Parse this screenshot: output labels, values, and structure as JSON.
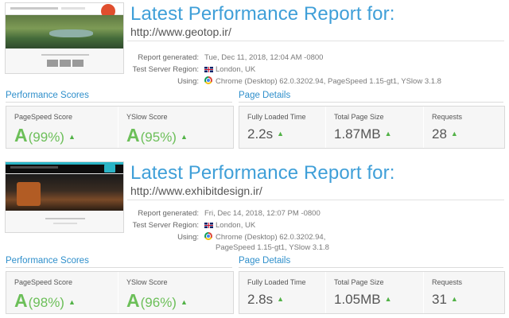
{
  "reports": [
    {
      "title": "Latest Performance Report for:",
      "url": "http://www.geotop.ir/",
      "meta": {
        "generated_label": "Report generated:",
        "generated_value": "Tue, Dec 11, 2018, 12:04 AM -0800",
        "region_label": "Test Server Region:",
        "region_value": "London, UK",
        "using_label": "Using:",
        "using_line1": "Chrome (Desktop) 62.0.3202.94, PageSpeed 1.15-gt1, YSlow 3.1.8",
        "using_line2": ""
      },
      "scores": {
        "title": "Performance Scores",
        "pagespeed_label": "PageSpeed Score",
        "pagespeed_grade": "A",
        "pagespeed_pct": "(99%)",
        "yslow_label": "YSlow Score",
        "yslow_grade": "A",
        "yslow_pct": "(95%)"
      },
      "details": {
        "title": "Page Details",
        "load_label": "Fully Loaded Time",
        "load_value": "2.2s",
        "size_label": "Total Page Size",
        "size_value": "1.87MB",
        "req_label": "Requests",
        "req_value": "28"
      },
      "icons": {
        "trend": "arrow-up-icon",
        "flag": "uk-flag-icon",
        "browser": "chrome-icon"
      }
    },
    {
      "title": "Latest Performance Report for:",
      "url": "http://www.exhibitdesign.ir/",
      "meta": {
        "generated_label": "Report generated:",
        "generated_value": "Fri, Dec 14, 2018, 12:07 PM -0800",
        "region_label": "Test Server Region:",
        "region_value": "London, UK",
        "using_label": "Using:",
        "using_line1": "Chrome (Desktop) 62.0.3202.94,",
        "using_line2": "PageSpeed 1.15-gt1, YSlow 3.1.8"
      },
      "scores": {
        "title": "Performance Scores",
        "pagespeed_label": "PageSpeed Score",
        "pagespeed_grade": "A",
        "pagespeed_pct": "(98%)",
        "yslow_label": "YSlow Score",
        "yslow_grade": "A",
        "yslow_pct": "(96%)"
      },
      "details": {
        "title": "Page Details",
        "load_label": "Fully Loaded Time",
        "load_value": "2.8s",
        "size_label": "Total Page Size",
        "size_value": "1.05MB",
        "req_label": "Requests",
        "req_value": "31"
      },
      "icons": {
        "trend": "arrow-up-icon",
        "flag": "uk-flag-icon",
        "browser": "chrome-icon"
      }
    }
  ],
  "colors": {
    "title_blue": "#3f9fd8",
    "section_blue": "#2f8fcb",
    "grade_green": "#6cbf59",
    "arrow_green": "#52b247",
    "panel_bg": "#f6f6f6"
  }
}
